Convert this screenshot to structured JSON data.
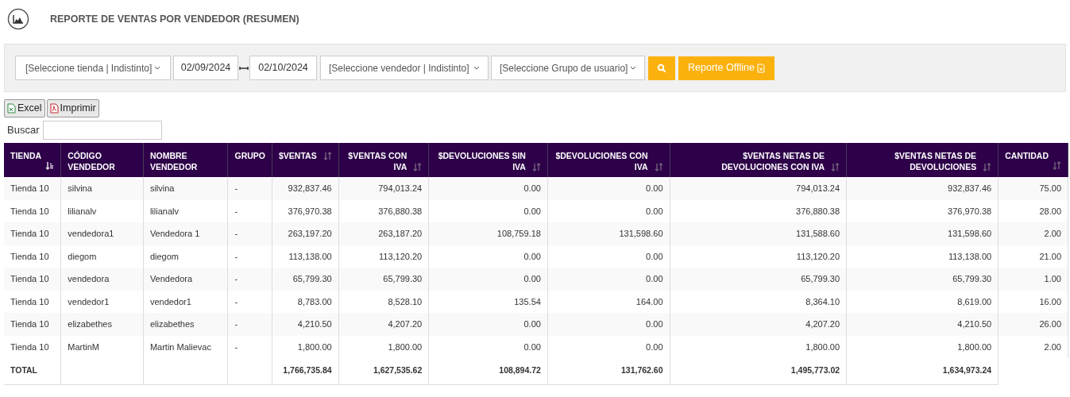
{
  "header": {
    "title": "REPORTE DE VENTAS POR VENDEDOR (RESUMEN)"
  },
  "filters": {
    "store_select": "[Seleccione tienda | Indistinto]",
    "date_from": "02/09/2024",
    "date_to": "02/10/2024",
    "seller_select": "[Seleccione vendedor | Indistinto]",
    "group_select": "[Seleccione Grupo de usuario]",
    "offline_button": "Reporte Offline"
  },
  "export_buttons": [
    {
      "kind": "excel",
      "label": "Excel"
    },
    {
      "kind": "pdf",
      "label": "Imprimir"
    }
  ],
  "search": {
    "label": "Buscar"
  },
  "table": {
    "columns": [
      {
        "label": "TIENDA",
        "kind": "text",
        "sorted": true
      },
      {
        "label": "CÓDIGO VENDEDOR",
        "kind": "text"
      },
      {
        "label": "NOMBRE VENDEDOR",
        "kind": "text"
      },
      {
        "label": "GRUPO",
        "kind": "text"
      },
      {
        "label": "$VENTAS",
        "kind": "number",
        "sorted": false
      },
      {
        "label": "$VENTAS CON IVA",
        "kind": "number",
        "sorted": false
      },
      {
        "label": "$DEVOLUCIONES SIN IVA",
        "kind": "number",
        "sorted": false
      },
      {
        "label": "$DEVOLUCIONES CON IVA",
        "kind": "number",
        "sorted": false
      },
      {
        "label": "$VENTAS NETAS DE DEVOLUCIONES CON IVA",
        "kind": "number",
        "sorted": false
      },
      {
        "label": "$VENTAS NETAS DE DEVOLUCIONES",
        "kind": "number",
        "sorted": false
      },
      {
        "label": "CANTIDAD",
        "kind": "text",
        "sorted": false
      }
    ],
    "rows": [
      [
        "Tienda 10",
        "silvina",
        "silvina",
        "-",
        "932,837.46",
        "794,013.24",
        "0.00",
        "0.00",
        "794,013.24",
        "932,837.46",
        "75.00"
      ],
      [
        "Tienda 10",
        "lilianalv",
        "lilianalv",
        "-",
        "376,970.38",
        "376,880.38",
        "0.00",
        "0.00",
        "376,880.38",
        "376,970.38",
        "28.00"
      ],
      [
        "Tienda 10",
        "vendedora1",
        "Vendedora 1",
        "-",
        "263,197.20",
        "263,187.20",
        "108,759.18",
        "131,598.60",
        "131,588.60",
        "131,598.60",
        "2.00"
      ],
      [
        "Tienda 10",
        "diegom",
        "diegom",
        "-",
        "113,138.00",
        "113,120.20",
        "0.00",
        "0.00",
        "113,120.20",
        "113,138.00",
        "21.00"
      ],
      [
        "Tienda 10",
        "vendedora",
        "Vendedora",
        "-",
        "65,799.30",
        "65,799.30",
        "0.00",
        "0.00",
        "65,799.30",
        "65,799.30",
        "1.00"
      ],
      [
        "Tienda 10",
        "vendedor1",
        "vendedor1",
        "-",
        "8,783.00",
        "8,528.10",
        "135.54",
        "164.00",
        "8,364.10",
        "8,619.00",
        "16.00"
      ],
      [
        "Tienda 10",
        "elizabethes",
        "elizabethes",
        "-",
        "4,210.50",
        "4,207.20",
        "0.00",
        "0.00",
        "4,207.20",
        "4,210.50",
        "26.00"
      ],
      [
        "Tienda 10",
        "MartinM",
        "Martin Malievac",
        "-",
        "1,800.00",
        "1,800.00",
        "0.00",
        "0.00",
        "1,800.00",
        "1,800.00",
        "2.00"
      ]
    ],
    "totals": {
      "label": "TOTAL",
      "values": [
        "1,766,735.84",
        "1,627,535.62",
        "108,894.72",
        "131,762.60",
        "1,495,773.02",
        "1,634,973.24"
      ]
    }
  }
}
